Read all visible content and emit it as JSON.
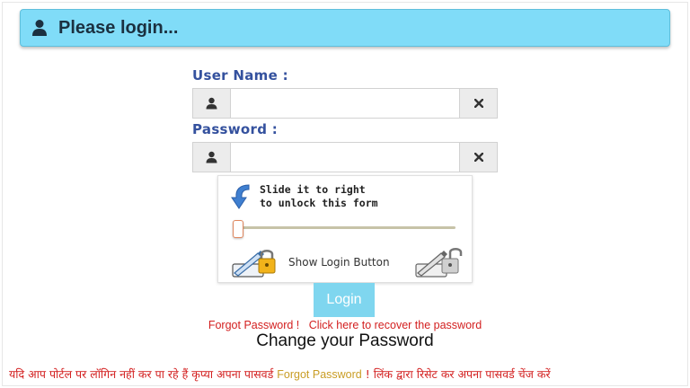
{
  "header": {
    "title": "Please login...",
    "icon": "user-icon"
  },
  "username": {
    "label": "User Name :",
    "value": "",
    "placeholder": ""
  },
  "password": {
    "label": "Password :",
    "value": "",
    "placeholder": ""
  },
  "slider": {
    "hint_line1": "Slide it to right",
    "hint_line2": "to unlock this form",
    "position": 0,
    "status_text": "Show Login Button"
  },
  "login_button": "Login",
  "forgot": {
    "prefix": "Forgot Password !",
    "link": "Click here to recover the password"
  },
  "change_password": "Change your Password",
  "notice": {
    "part1": "यदि आप पोर्टल पर लॉगिन नहीं कर पा रहे हैं कृप्या अपना पासवर्ड ",
    "link": "Forgot Password",
    "part2": " ! लिंक द्वारा रिसेट कर अपना पासवर्ड चेंज करें"
  },
  "colors": {
    "header_bg": "#80dcf8",
    "label": "#34519e",
    "login_button": "#7fd6ef",
    "alert_red": "#d32020",
    "link_gold": "#c99d25"
  }
}
